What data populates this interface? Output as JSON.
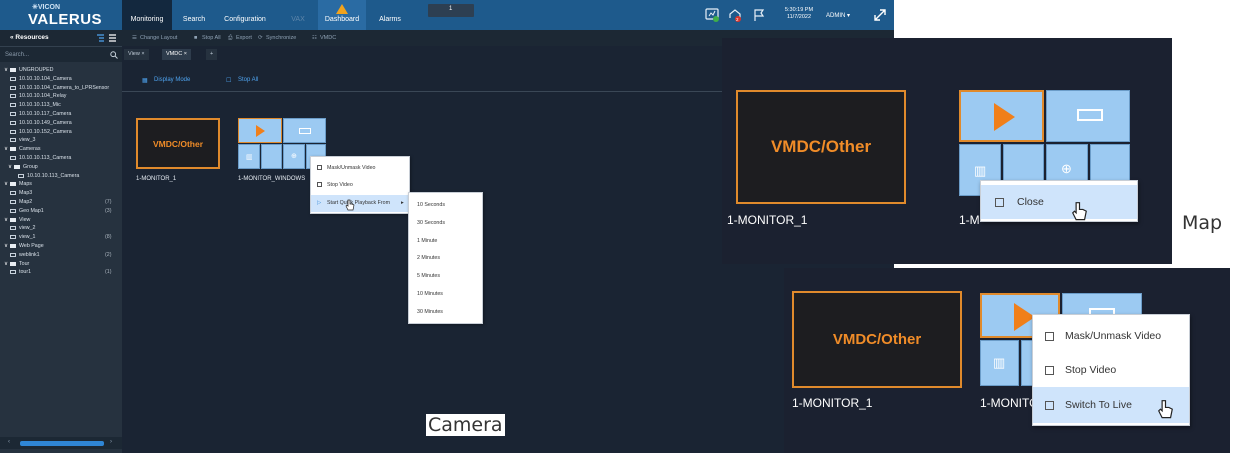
{
  "topbar": {
    "logo_small": "✳VICON",
    "logo_big": "VALERUS",
    "tabs": [
      {
        "label": "Monitoring"
      },
      {
        "label": "Search"
      },
      {
        "label": "Configuration"
      },
      {
        "label": "VAX"
      },
      {
        "label": "Dashboard"
      },
      {
        "label": "Alarms"
      }
    ],
    "alarm_count": "1",
    "clock_time": "5:30:19 PM",
    "clock_date": "11/7/2022",
    "user": "ADMIN ▾",
    "notification_badge": "2",
    "accent_color": "#1e5a8c"
  },
  "sidebar": {
    "title": "« Resources",
    "search_placeholder": "Search...",
    "items": [
      {
        "label": "UNGROUPED",
        "count": "",
        "icon": "folder-icon"
      },
      {
        "label": "10.10.10.104_Camera",
        "count": "",
        "icon": "camera-icon"
      },
      {
        "label": "10.10.10.104_Camera_to_LPRSensor",
        "count": "",
        "icon": "lpr-icon"
      },
      {
        "label": "10.10.10.104_Relay",
        "count": "",
        "icon": "relay-icon"
      },
      {
        "label": "10.10.10.113_Mic",
        "count": "",
        "icon": "mic-icon"
      },
      {
        "label": "10.10.10.117_Camera",
        "count": "",
        "icon": "camera-icon"
      },
      {
        "label": "10.10.10.149_Camera",
        "count": "",
        "icon": "camera-icon"
      },
      {
        "label": "10.10.10.152_Camera",
        "count": "",
        "icon": "camera-icon"
      },
      {
        "label": "view_3",
        "count": "",
        "icon": "view-icon"
      },
      {
        "label": "Cameras",
        "count": "",
        "icon": "folder-icon"
      },
      {
        "label": "10.10.10.113_Camera",
        "count": "",
        "icon": "camera-icon"
      },
      {
        "label": "Group",
        "count": "",
        "icon": "folder-icon"
      },
      {
        "label": "10.10.10.113_Camera",
        "count": "",
        "icon": "camera-icon"
      },
      {
        "label": "Maps",
        "count": "",
        "icon": "folder-icon"
      },
      {
        "label": "Map3",
        "count": "",
        "icon": "map-icon"
      },
      {
        "label": "Map2",
        "count": "(7)",
        "icon": "map-icon"
      },
      {
        "label": "Geo Map1",
        "count": "(3)",
        "icon": "map-icon"
      },
      {
        "label": "View",
        "count": "",
        "icon": "folder-icon"
      },
      {
        "label": "view_2",
        "count": "",
        "icon": "view-icon"
      },
      {
        "label": "view_1",
        "count": "(8)",
        "icon": "view-icon"
      },
      {
        "label": "Web Page",
        "count": "",
        "icon": "folder-icon"
      },
      {
        "label": "weblink1",
        "count": "(2)",
        "icon": "globe-icon"
      },
      {
        "label": "Tour",
        "count": "",
        "icon": "folder-icon"
      },
      {
        "label": "tour1",
        "count": "(1)",
        "icon": "tour-icon"
      }
    ]
  },
  "toolbar": {
    "change_layout": "Change Layout",
    "stop_all": "Stop All",
    "export": "Export",
    "synchronize": "Synchronize",
    "vmdc": "VMDC"
  },
  "view_tabs": [
    {
      "label": "View ×"
    },
    {
      "label": "VMDC ×"
    },
    {
      "label": "+"
    }
  ],
  "modebar": {
    "display_mode": "Display Mode",
    "stop_all": "Stop All"
  },
  "tiles": {
    "vmdc_text": "VMDC/Other",
    "monitor1_label": "1-MONITOR_1",
    "monitor2_label": "1-MONITOR_WINDOWS"
  },
  "context_menu": {
    "items": [
      "Mask/Unmask Video",
      "Stop Video",
      "Start Quick Playback From"
    ],
    "arrow": "▸"
  },
  "playback_submenu": [
    "10 Seconds",
    "30 Seconds",
    "1 Minute",
    "2 Minutes",
    "5 Minutes",
    "10 Minutes",
    "30 Minutes"
  ],
  "zoom_map": {
    "vmdc_text": "VMDC/Other",
    "monitor1_label": "1-MONITOR_1",
    "monitor2_label_part": "1-M",
    "menu_item": "Close",
    "caption": "Map"
  },
  "zoom_camera": {
    "vmdc_text": "VMDC/Other",
    "monitor1_label": "1-MONITOR_1",
    "monitor2_label_part": "1-MONITO",
    "menu_items": [
      "Mask/Unmask Video",
      "Stop Video",
      "Switch To Live"
    ],
    "caption": "Camera"
  },
  "colors": {
    "tile_border": "#e08a2c",
    "grid_blue": "#9ccaf2",
    "link_blue": "#4ea3ef",
    "highlight": "#cfe4fb"
  }
}
